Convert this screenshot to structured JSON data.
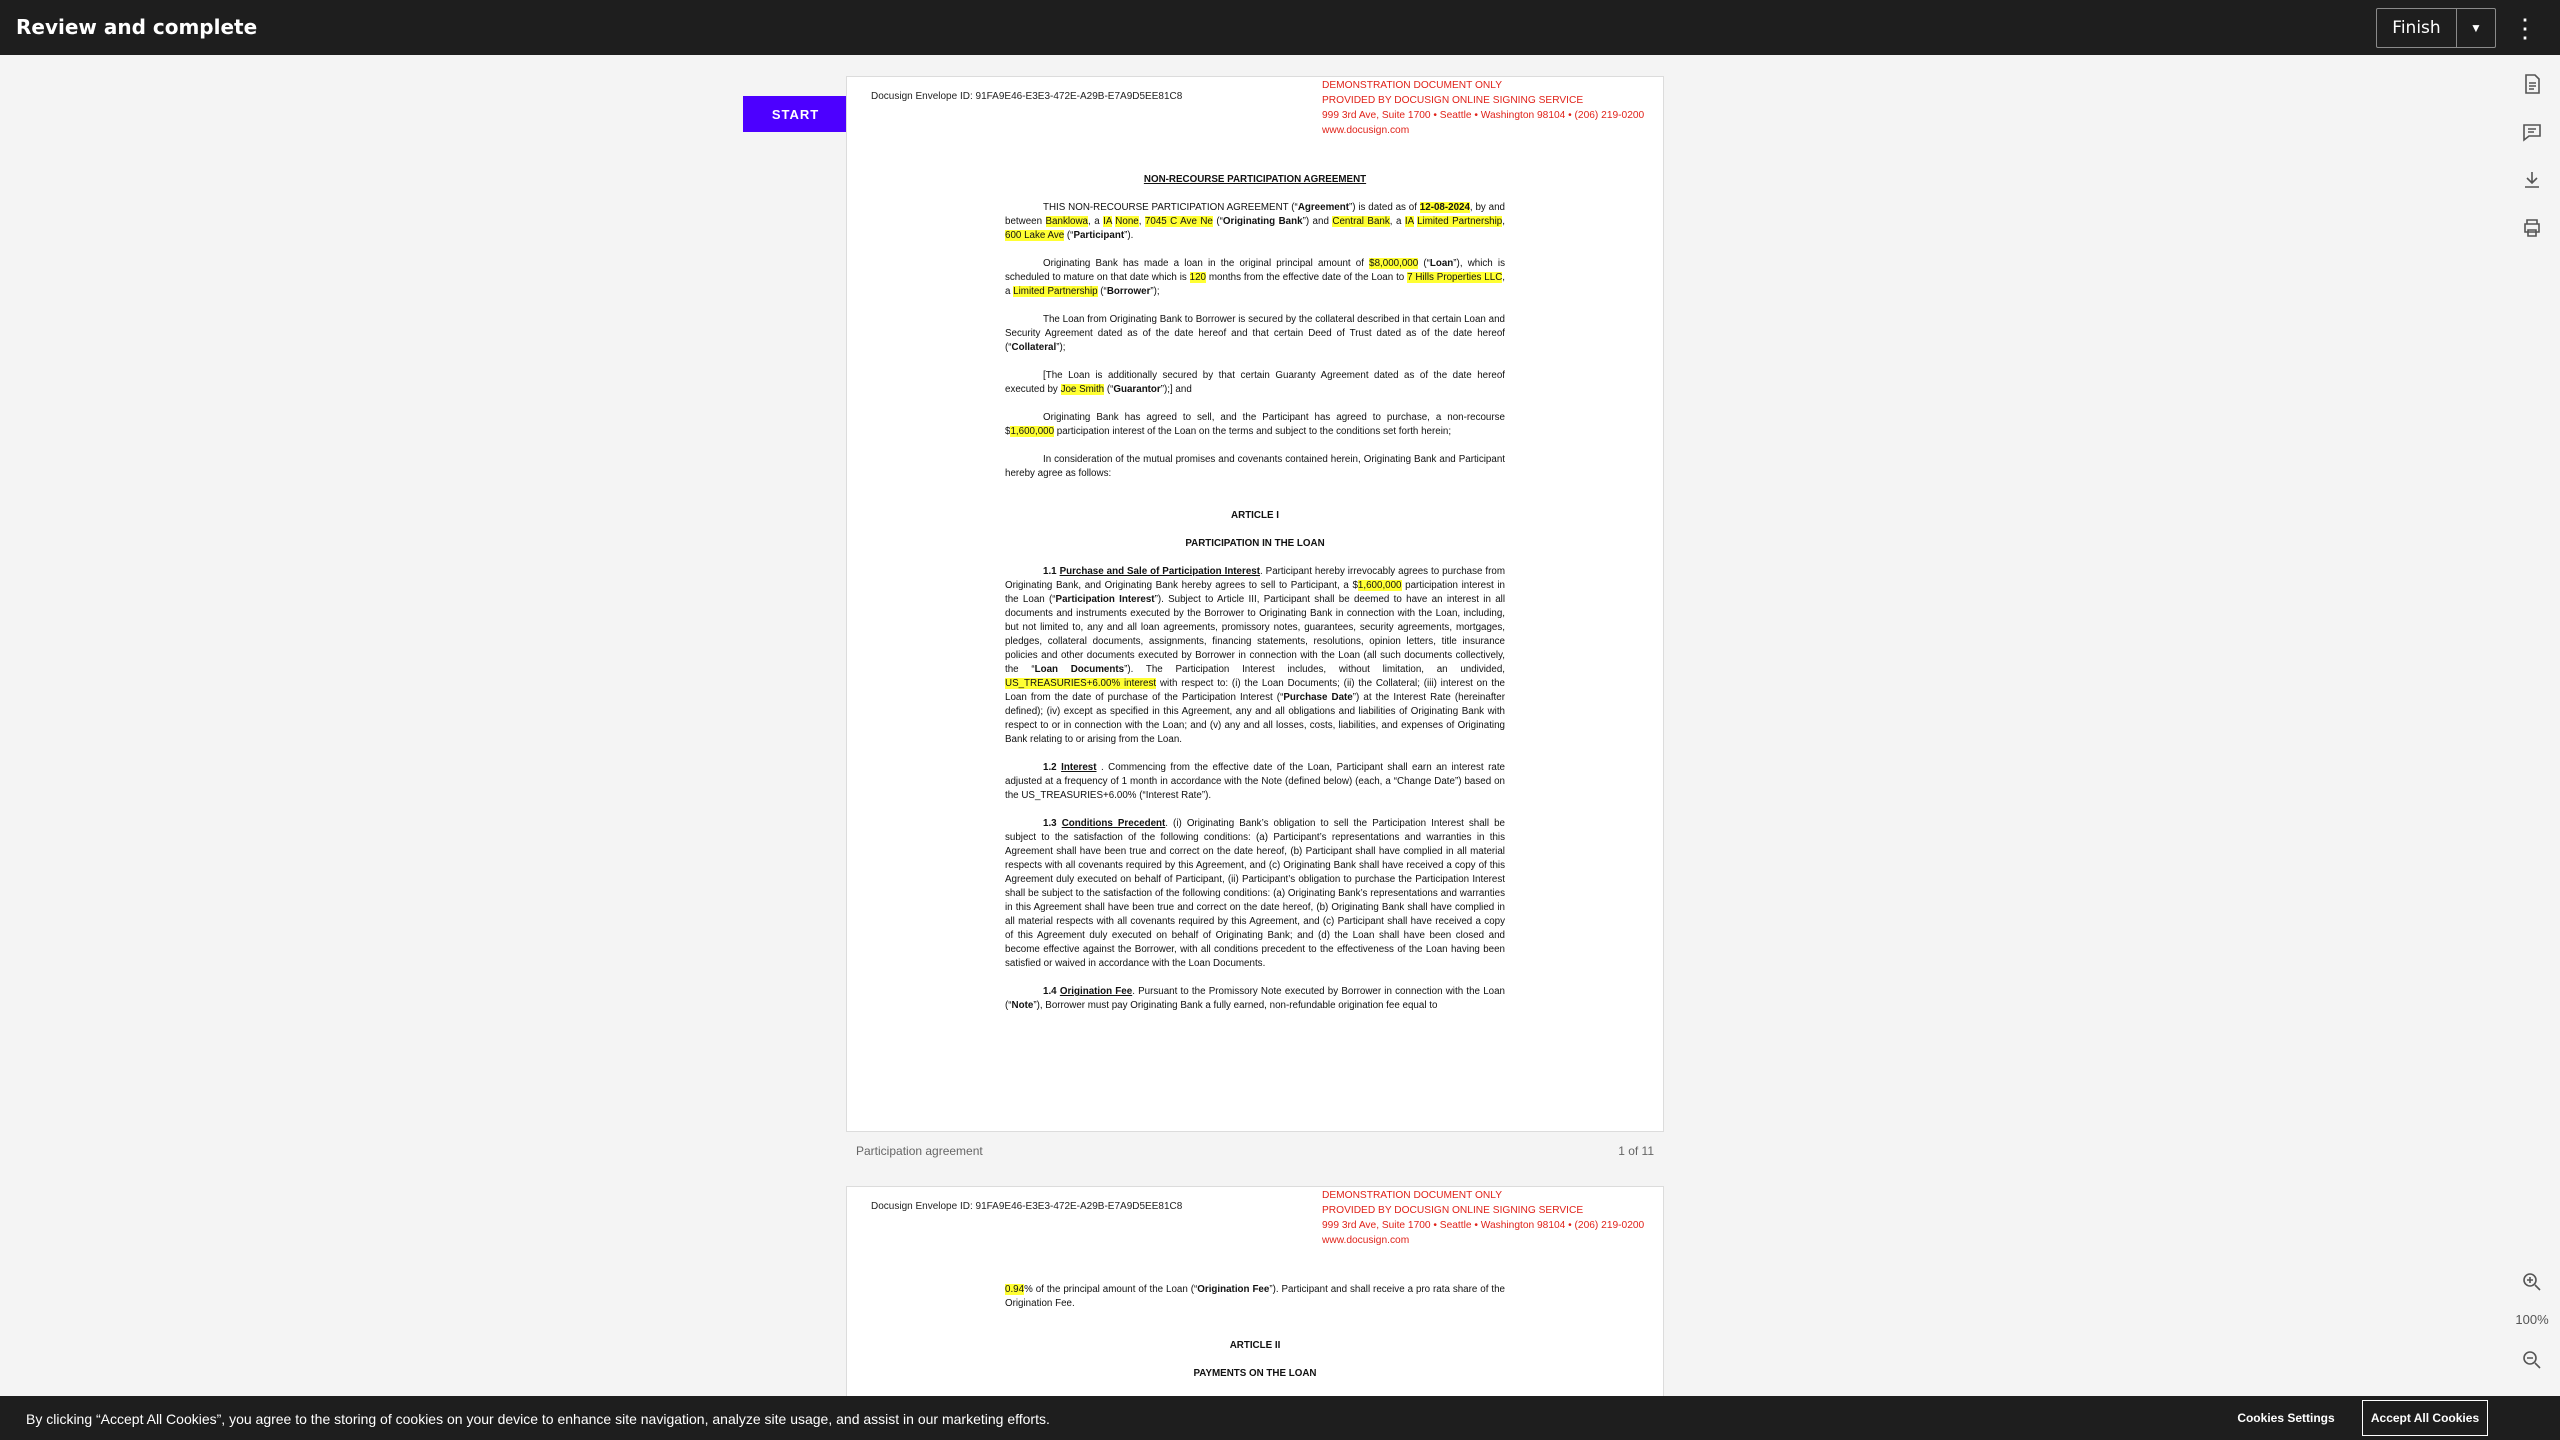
{
  "header": {
    "title": "Review and complete",
    "finish_label": "Finish",
    "caret_icon": "caret-down-icon",
    "menu_icon": "kebab-menu-icon"
  },
  "toolbar": {
    "icons": [
      "document-icon",
      "comment-icon",
      "download-icon",
      "print-icon",
      "zoom-in-icon",
      "zoom-out-icon"
    ],
    "zoom_level": "100%"
  },
  "start_label": "START",
  "document": {
    "envelope_id": "Docusign Envelope ID: 91FA9E46-E3E3-472E-A29B-E7A9D5EE81C8",
    "demo_lines": [
      "DEMONSTRATION DOCUMENT ONLY",
      "PROVIDED BY DOCUSIGN ONLINE SIGNING SERVICE",
      "999 3rd Ave, Suite 1700  •  Seattle • Washington 98104 • (206) 219-0200",
      "www.docusign.com"
    ],
    "title": "NON-RECOURSE PARTICIPATION AGREEMENT",
    "name": "Participation agreement",
    "page_count": "1 of 11",
    "fields": {
      "date": "12-08-2024",
      "bank_name": "Banklowa",
      "state": "IA",
      "state_type": "None",
      "bank_address": "7045 C Ave Ne",
      "participant": "Central Bank",
      "participant_state": "IA",
      "participant_type": "Limited Partnership",
      "participant_address": "600 Lake Ave",
      "loan_amount": "$8,000,000",
      "months": "120",
      "borrower": "7 Hills Properties LLC",
      "borrower_type": "Limited Partnership",
      "guarantor": "Joe Smith",
      "participation_amount": "1,600,000",
      "interest_rate": "US_TREASURIES+6.00% interest",
      "origination_pct": "0.94"
    },
    "articles": {
      "a1": "ARTICLE I",
      "a1_title": "PARTICIPATION IN THE LOAN",
      "a2": "ARTICLE II",
      "a2_title": "PAYMENTS ON THE LOAN"
    }
  },
  "cookie": {
    "text": "By clicking “Accept All Cookies”, you agree to the storing of cookies on your device to enhance site navigation, analyze site usage, and assist in our marketing efforts.",
    "settings_label": "Cookies Settings",
    "accept_label": "Accept All Cookies"
  }
}
